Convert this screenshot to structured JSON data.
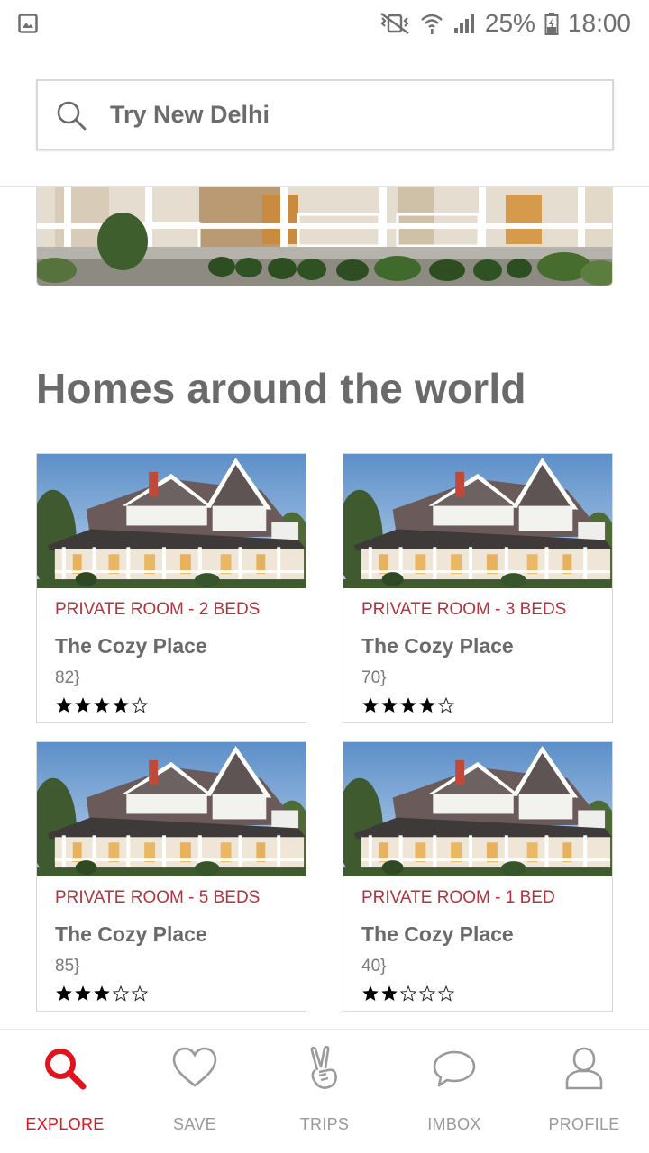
{
  "status_bar": {
    "battery": "25%",
    "time": "18:00"
  },
  "search": {
    "placeholder": "Try New Delhi"
  },
  "section": {
    "title": "Homes around the world"
  },
  "listings": [
    {
      "type": "PRIVATE ROOM - 2 BEDS",
      "title": "The Cozy Place",
      "price": "82}",
      "rating": 4,
      "max_rating": 5
    },
    {
      "type": "PRIVATE ROOM - 3 BEDS",
      "title": "The Cozy Place",
      "price": "70}",
      "rating": 4,
      "max_rating": 5
    },
    {
      "type": "PRIVATE ROOM - 5 BEDS",
      "title": "The Cozy Place",
      "price": "85}",
      "rating": 3,
      "max_rating": 5
    },
    {
      "type": "PRIVATE ROOM - 1 BED",
      "title": "The Cozy Place",
      "price": "40}",
      "rating": 2,
      "max_rating": 5
    }
  ],
  "nav": {
    "items": [
      {
        "label": "EXPLORE",
        "icon": "search-icon",
        "active": true
      },
      {
        "label": "SAVE",
        "icon": "heart-icon",
        "active": false
      },
      {
        "label": "TRIPS",
        "icon": "peace-hand-icon",
        "active": false
      },
      {
        "label": "IMBOX",
        "icon": "chat-bubble-icon",
        "active": false
      },
      {
        "label": "PROFILE",
        "icon": "person-icon",
        "active": false
      }
    ]
  },
  "colors": {
    "accent": "#e0141e",
    "listing_type": "#b5323c",
    "text": "#6a6a6a",
    "inactive_nav": "#9a9a9a"
  }
}
